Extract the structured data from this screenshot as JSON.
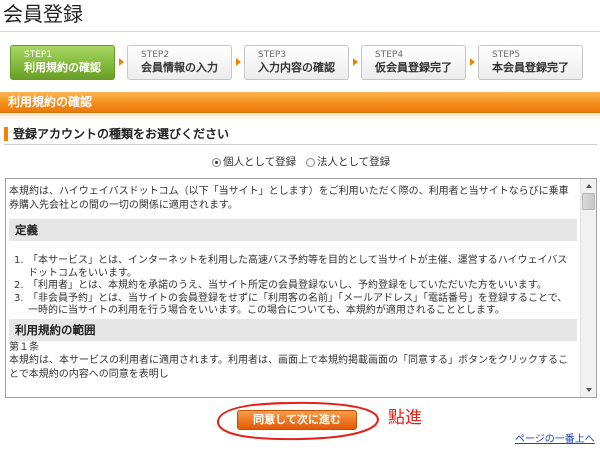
{
  "page": {
    "title": "会員登録"
  },
  "steps": [
    {
      "step": "STEP1",
      "label": "利用規約の確認",
      "active": true
    },
    {
      "step": "STEP2",
      "label": "会員情報の入力",
      "active": false
    },
    {
      "step": "STEP3",
      "label": "入力内容の確認",
      "active": false
    },
    {
      "step": "STEP4",
      "label": "仮会員登録完了",
      "active": false
    },
    {
      "step": "STEP5",
      "label": "本会員登録完了",
      "active": false
    }
  ],
  "section": {
    "header": "利用規約の確認"
  },
  "account_type": {
    "heading": "登録アカウントの種類をお選びください",
    "options": [
      {
        "label": "個人として登録",
        "selected": true
      },
      {
        "label": "法人として登録",
        "selected": false
      }
    ]
  },
  "terms": {
    "intro": "本規約は、ハイウェイバスドットコム（以下「当サイト」とします）をご利用いただく際の、利用者と当サイトならびに乗車券購入先会社との間の一切の関係に適用されます。",
    "definitions": {
      "heading": "定義",
      "items": [
        {
          "num": "1.",
          "text": "「本サービス」とは、インターネットを利用した高速バス予約等を目的として当サイトが主催、運営するハイウェイバスドットコムをいいます。"
        },
        {
          "num": "2.",
          "text": "「利用者」とは、本規約を承諾のうえ、当サイト所定の会員登録ないし、予約登録をしていただいた方をいいます。"
        },
        {
          "num": "3.",
          "text": "「非会員予約」とは、当サイトの会員登録をせずに「利用客の名前」「メールアドレス」「電話番号」を登録することで、一時的に当サイトの利用を行う場合をいいます。この場合についても、本規約が適用されることとします。"
        }
      ]
    },
    "scope": {
      "heading": "利用規約の範囲",
      "article": "第１条",
      "text": "本規約は、本サービスの利用者に適用されます。利用者は、画面上で本規約掲載画面の「同意する」ボタンをクリックすることで本規約の内容への同意を表明し"
    }
  },
  "actions": {
    "agree_button": "同意して次に進む",
    "back_to_top": "ページの一番上へ"
  },
  "annotation": {
    "text": "點進"
  },
  "colors": {
    "accent_orange": "#f08300",
    "step_active_green": "#7ab233",
    "annotation_red": "#e2231a",
    "link_blue": "#1a44cc"
  }
}
